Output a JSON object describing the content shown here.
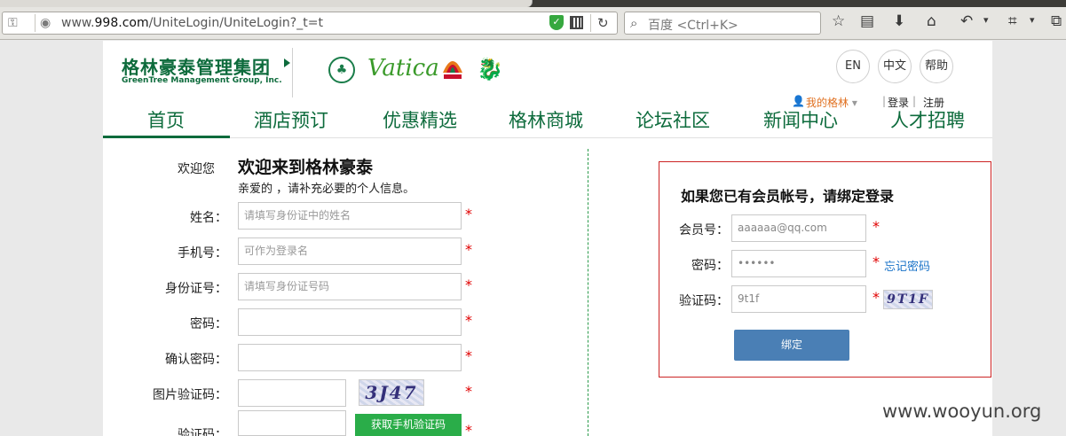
{
  "browser": {
    "url_prefix": "www.",
    "url_host": "998.com",
    "url_path": "/UniteLogin/UniteLogin?_t=t",
    "search_placeholder": "百度 <Ctrl+K>"
  },
  "header": {
    "logo_cn": "格林豪泰管理集团",
    "logo_en": "GreenTree  Management Group, Inc.",
    "brand_vatica": "Vatica",
    "lang_en": "EN",
    "lang_zh": "中文",
    "help": "帮助",
    "my_account": "我的格林",
    "login": "登录",
    "register": "注册"
  },
  "nav": {
    "items": [
      "首页",
      "酒店预订",
      "优惠精选",
      "格林商城",
      "论坛社区",
      "新闻中心",
      "人才招聘"
    ]
  },
  "register_form": {
    "welcome_small": "欢迎您",
    "welcome_title": "欢迎来到格林豪泰",
    "subtitle": "亲爱的 ，请补充必要的个人信息。",
    "name_label": "姓名：",
    "name_placeholder": "请填写身份证中的姓名",
    "phone_label": "手机号：",
    "phone_placeholder": "可作为登录名",
    "id_label": "身份证号：",
    "id_placeholder": "请填写身份证号码",
    "password_label": "密码：",
    "confirm_label": "确认密码：",
    "captcha_label": "图片验证码：",
    "captcha_text": "3J47",
    "sms_label": "验证码：",
    "sms_button": "获取手机验证码",
    "required": "*"
  },
  "bind_form": {
    "title": "如果您已有会员帐号，请绑定登录",
    "member_label": "会员号：",
    "member_value": "aaaaaa@qq.com",
    "password_label": "密码：",
    "password_value": "••••••",
    "forgot": "忘记密码",
    "captcha_label": "验证码：",
    "captcha_value": "9t1f",
    "captcha_text": "9T1F",
    "bind_button": "绑定",
    "required": "*"
  },
  "watermark": "www.wooyun.org",
  "colors": {
    "brand_green": "#0d6b3c",
    "required_red": "#e00000",
    "bind_border": "#cc2424",
    "bind_button": "#4a7fb5",
    "sms_button": "#2aad49",
    "link_blue": "#1a73c8"
  }
}
